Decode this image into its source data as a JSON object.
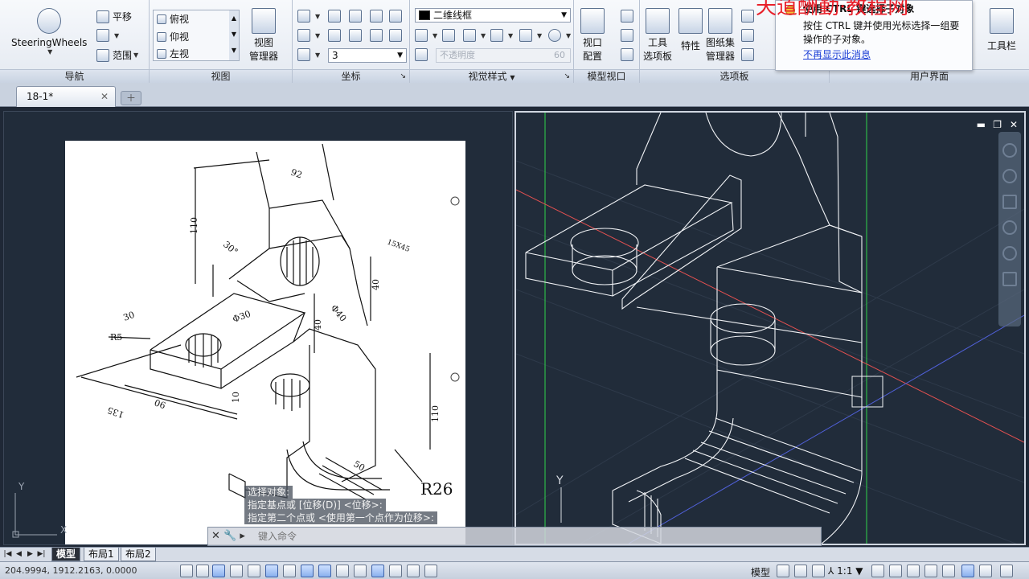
{
  "ribbon": {
    "nav_panel": {
      "title": "导航",
      "steering": "SteeringWheels",
      "pan": "平移",
      "range": "范围"
    },
    "view_panel": {
      "title": "视图",
      "views": [
        "俯视",
        "仰视",
        "左视"
      ],
      "manager": "视图\n管理器"
    },
    "coord_panel": {
      "title": "坐标",
      "value": "3"
    },
    "visual_panel": {
      "title": "视觉样式",
      "style": "二维线框",
      "opacity_label": "不透明度",
      "opacity_value": "60"
    },
    "model_vp_panel": {
      "title": "模型视口",
      "config": "视口\n配置"
    },
    "palette_panel": {
      "title": "选项板",
      "tool_palette": "工具\n选项板",
      "properties": "特性",
      "sheetset": "图纸集\n管理器"
    },
    "ui_panel": {
      "title": "用户界面",
      "toolbar": "工具栏",
      "user": "用户"
    }
  },
  "tooltip": {
    "title": "使用 CTRL 键选择子对象",
    "body": "按住 CTRL 键并使用光标选择一组要操作的子对象。",
    "link": "不再显示此消息"
  },
  "watermark": "天道酬勤·教程网",
  "tabs": {
    "document": "18-1*"
  },
  "drawing_labels": {
    "dim_92": "92",
    "dim_110": "110",
    "dim_30deg": "30°",
    "dim_15x45": "15X45",
    "dim_40a": "40",
    "dim_phi40": "Φ40",
    "dim_phi30": "Φ30",
    "dim_30": "30",
    "dim_r5": "R5",
    "dim_40b": "40",
    "dim_135": "135",
    "dim_90": "90",
    "dim_10": "10",
    "dim_110b": "110",
    "dim_r26": "R26",
    "dim_50": "50"
  },
  "command": {
    "history": [
      "选择对象:",
      "指定基点或 [位移(D)] <位移>:",
      "指定第二个点或 <使用第一个点作为位移>:"
    ],
    "placeholder": "键入命令"
  },
  "layout_tabs": [
    "模型",
    "布局1",
    "布局2"
  ],
  "status": {
    "coords": "204.9994, 1912.2163, 0.0000",
    "model": "模型",
    "scale": "1:1"
  },
  "colors": {
    "workspace": "#212c3a",
    "grid_green": "#2fd34a",
    "axis_red": "#e25050",
    "axis_blue": "#5060d8"
  }
}
